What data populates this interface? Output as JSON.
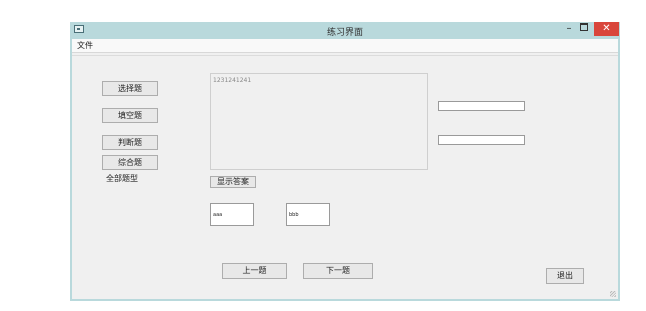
{
  "window": {
    "title": "练习界面",
    "min_label": "–",
    "close_label": "✕"
  },
  "menu": {
    "file": "文件"
  },
  "left_panel": {
    "buttons": [
      "选择题",
      "填空题",
      "判断题",
      "综合题"
    ],
    "all_types_label": "全部题型"
  },
  "question": {
    "text": "1231241241"
  },
  "show_answer_label": "显示答案",
  "answer_a": "aaa",
  "answer_b": "bbb",
  "nav": {
    "prev_label": "上一题",
    "next_label": "下一题",
    "exit_label": "退出"
  },
  "colors": {
    "titlebar": "#b9d9dc",
    "close": "#d9463b",
    "client_bg": "#f0f0f0"
  }
}
